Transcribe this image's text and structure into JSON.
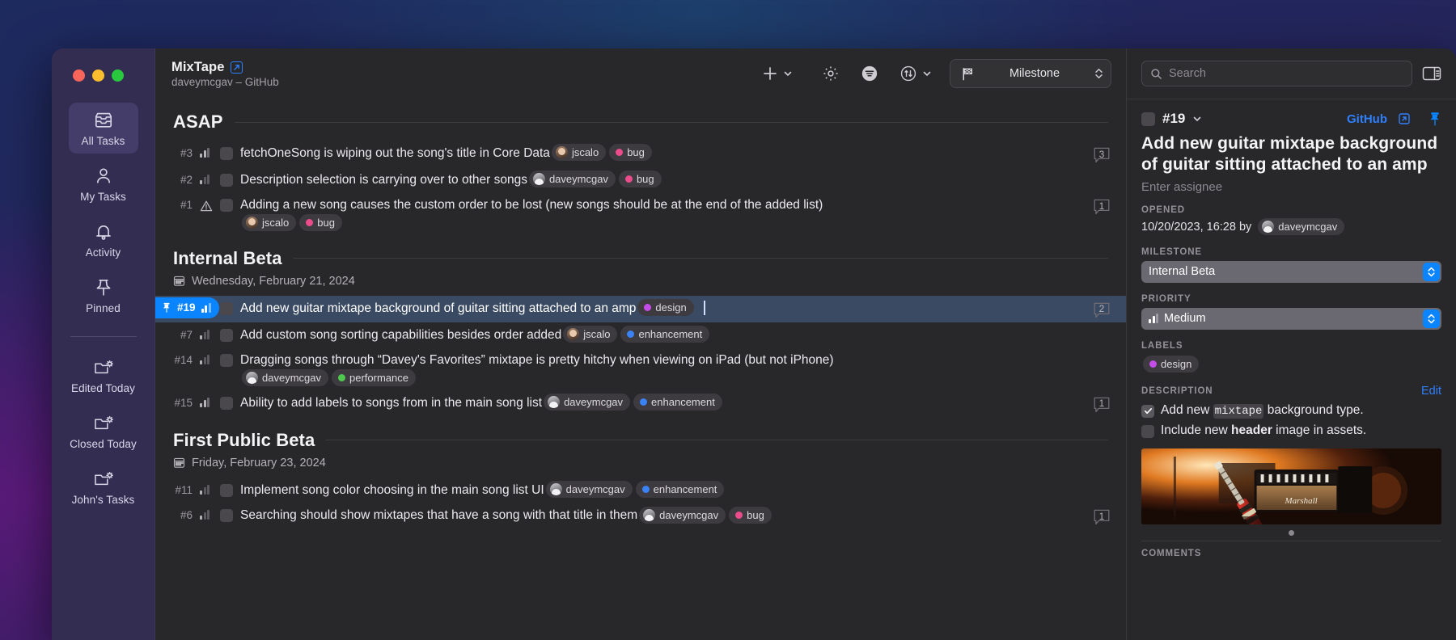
{
  "window": {
    "traffic_lights": [
      "close",
      "minimize",
      "zoom"
    ]
  },
  "header": {
    "project_name": "MixTape",
    "project_subtitle": "daveymcgav – GitHub",
    "external_link_icon": "external-link-icon",
    "toolbar": {
      "add_label": "+",
      "gear_icon": "gear-icon",
      "filter_icon": "filter-icon",
      "sort_icon": "sort-arrows-icon",
      "milestone_icon": "checkered-flag-icon",
      "milestone_label": "Milestone"
    }
  },
  "sidebar": {
    "items": [
      {
        "label": "All Tasks",
        "icon": "inbox-icon",
        "active": true
      },
      {
        "label": "My Tasks",
        "icon": "person-icon",
        "active": false
      },
      {
        "label": "Activity",
        "icon": "bell-icon",
        "active": false
      },
      {
        "label": "Pinned",
        "icon": "pin-icon",
        "active": false
      }
    ],
    "smart_items": [
      {
        "label": "Edited Today",
        "icon": "smart-folder-icon"
      },
      {
        "label": "Closed Today",
        "icon": "smart-folder-icon"
      },
      {
        "label": "John's Tasks",
        "icon": "smart-folder-icon"
      }
    ]
  },
  "groups": [
    {
      "title": "ASAP",
      "date": null,
      "rows": [
        {
          "number": "#3",
          "priority": "medium",
          "title": "fetchOneSong is wiping out the song's title in Core Data",
          "assignee": "jscalo",
          "avatar": "jscalo",
          "labels": [
            {
              "name": "bug",
              "color": "#ec4c8c"
            }
          ],
          "comments": "3",
          "selected": false
        },
        {
          "number": "#2",
          "priority": "low",
          "title": "Description selection is carrying over to other songs",
          "assignee": "daveymcgav",
          "avatar": "davey",
          "labels": [
            {
              "name": "bug",
              "color": "#ec4c8c"
            }
          ],
          "comments": null,
          "selected": false
        },
        {
          "number": "#1",
          "priority": "critical",
          "title": "Adding a new song causes the custom order to be lost (new songs should be at the end of the added list)",
          "assignee": "jscalo",
          "avatar": "jscalo",
          "labels": [
            {
              "name": "bug",
              "color": "#ec4c8c"
            }
          ],
          "comments": "1",
          "wrap": true,
          "selected": false
        }
      ]
    },
    {
      "title": "Internal Beta",
      "date": "Wednesday, February 21, 2024",
      "rows": [
        {
          "number": "#19",
          "priority": "medium",
          "title": "Add new guitar mixtape background of guitar sitting attached to an amp",
          "assignee": null,
          "avatar": null,
          "labels": [
            {
              "name": "design",
              "color": "#c44ce8"
            }
          ],
          "comments": "2",
          "selected": true,
          "caret": true
        },
        {
          "number": "#7",
          "priority": "low",
          "title": "Add custom song sorting capabilities besides order added",
          "assignee": "jscalo",
          "avatar": "jscalo",
          "labels": [
            {
              "name": "enhancement",
              "color": "#3b82f6"
            }
          ],
          "comments": null,
          "selected": false
        },
        {
          "number": "#14",
          "priority": "low",
          "title": "Dragging songs through “Davey's Favorites” mixtape is pretty hitchy when viewing on iPad (but not iPhone)",
          "assignee": "daveymcgav",
          "avatar": "davey",
          "labels": [
            {
              "name": "performance",
              "color": "#4ec94e"
            }
          ],
          "comments": null,
          "wrap": true,
          "selected": false
        },
        {
          "number": "#15",
          "priority": "medium",
          "title": "Ability to add labels to songs from in the main song list",
          "assignee": "daveymcgav",
          "avatar": "davey",
          "labels": [
            {
              "name": "enhancement",
              "color": "#3b82f6"
            }
          ],
          "comments": "1",
          "selected": false
        }
      ]
    },
    {
      "title": "First Public Beta",
      "date": "Friday, February 23, 2024",
      "rows": [
        {
          "number": "#11",
          "priority": "low",
          "title": "Implement song color choosing in the main song list UI",
          "assignee": "daveymcgav",
          "avatar": "davey",
          "labels": [
            {
              "name": "enhancement",
              "color": "#3b82f6"
            }
          ],
          "comments": null,
          "selected": false
        },
        {
          "number": "#6",
          "priority": "low",
          "title": "Searching should show mixtapes that have a song with that title in them",
          "assignee": "daveymcgav",
          "avatar": "davey",
          "labels": [
            {
              "name": "bug",
              "color": "#ec4c8c"
            }
          ],
          "comments": "1",
          "selected": false
        }
      ]
    }
  ],
  "detail": {
    "search_placeholder": "Search",
    "sidebar_toggle_icon": "panel-toggle-icon",
    "issue_id": "#19",
    "github_label": "GitHub",
    "pin_icon": "pin-icon",
    "title": "Add new guitar mixtape background of guitar sitting attached to an amp",
    "assignee_placeholder": "Enter assignee",
    "opened_label": "OPENED",
    "opened_value": "10/20/2023, 16:28 by",
    "opened_author": "daveymcgav",
    "milestone_label": "MILESTONE",
    "milestone_value": "Internal Beta",
    "priority_label": "PRIORITY",
    "priority_value": "Medium",
    "labels_label": "LABELS",
    "labels": [
      {
        "name": "design",
        "color": "#c44ce8"
      }
    ],
    "description_label": "DESCRIPTION",
    "edit_label": "Edit",
    "description_items": [
      {
        "checked": true,
        "pre": "Add new ",
        "code": "mixtape",
        "post": " background type."
      },
      {
        "checked": false,
        "pre": "Include new ",
        "bold": "header",
        "post": " image in assets."
      }
    ],
    "attachment_alt": "guitar-leaning-on-marshall-amp",
    "comments_label": "COMMENTS"
  }
}
